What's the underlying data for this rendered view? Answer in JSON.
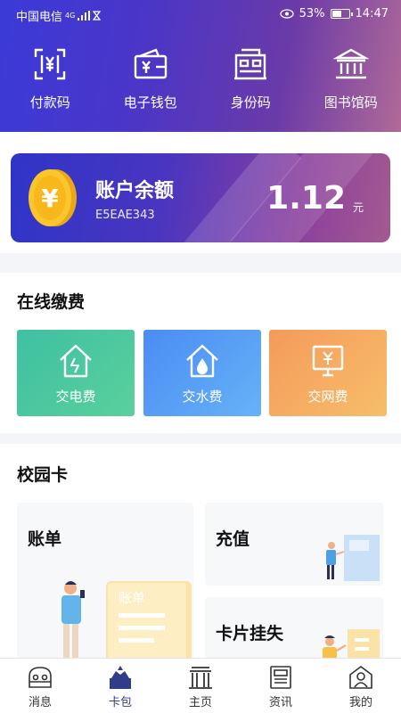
{
  "status_bar": {
    "carrier": "中国电信",
    "network": "4G",
    "battery": "53%",
    "battery_level": 0.53,
    "time": "14:47"
  },
  "quick_actions": [
    {
      "label": "付款码",
      "icon": "payment-code-icon"
    },
    {
      "label": "电子钱包",
      "icon": "wallet-icon"
    },
    {
      "label": "身份码",
      "icon": "id-code-icon"
    },
    {
      "label": "图书馆码",
      "icon": "library-icon"
    }
  ],
  "balance": {
    "title": "账户余额",
    "account_id": "E5EAE343",
    "amount": "1.12",
    "unit": "元",
    "coin_symbol": "¥"
  },
  "online_payment": {
    "title": "在线缴费",
    "items": [
      {
        "label": "交电费",
        "icon": "electricity-house-icon",
        "color": "#46c4a0"
      },
      {
        "label": "交水费",
        "icon": "water-house-icon",
        "color": "#55a0f5"
      },
      {
        "label": "交网费",
        "icon": "internet-monitor-icon",
        "color": "#f5aa60"
      }
    ]
  },
  "campus_card": {
    "title": "校园卡",
    "bill_label": "账单",
    "bill_illustration_text": "账单",
    "recharge_label": "充值",
    "report_loss_label": "卡片挂失"
  },
  "tabbar": [
    {
      "label": "消息",
      "icon": "message-icon",
      "active": false
    },
    {
      "label": "卡包",
      "icon": "card-pack-icon",
      "active": true
    },
    {
      "label": "主页",
      "icon": "home-building-icon",
      "active": false
    },
    {
      "label": "资讯",
      "icon": "news-icon",
      "active": false
    },
    {
      "label": "我的",
      "icon": "profile-icon",
      "active": false
    }
  ]
}
